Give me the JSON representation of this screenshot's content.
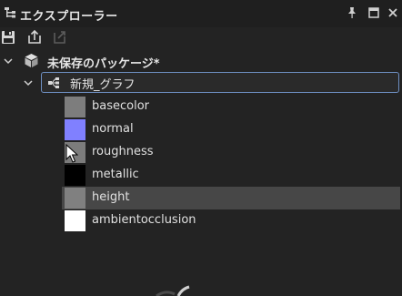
{
  "panel": {
    "title": "エクスプローラー",
    "icons": {
      "panel": "explorer-icon",
      "pin": "pin-icon",
      "window": "maximize-icon",
      "close": "close-icon"
    }
  },
  "toolbar": {
    "icons": [
      "save-icon",
      "export-icon",
      "refresh-icon"
    ]
  },
  "tree": {
    "package": {
      "label": "未保存のパッケージ*",
      "icon": "package-icon",
      "expanded": true
    },
    "graph": {
      "label": "新規_グラフ",
      "icon": "graph-icon",
      "expanded": true
    },
    "items": [
      {
        "label": "basecolor",
        "color": "#7d7d7d",
        "selected": false
      },
      {
        "label": "normal",
        "color": "#8080ff",
        "selected": false
      },
      {
        "label": "roughness",
        "color": "#7c7c7c",
        "selected": false
      },
      {
        "label": "metallic",
        "color": "#000000",
        "selected": false
      },
      {
        "label": "height",
        "color": "#808080",
        "selected": true
      },
      {
        "label": "ambientocclusion",
        "color": "#ffffff",
        "selected": false
      }
    ]
  },
  "colors": {
    "background": "#232323",
    "selection": "#474747",
    "focus_border": "#6e8fc2"
  }
}
